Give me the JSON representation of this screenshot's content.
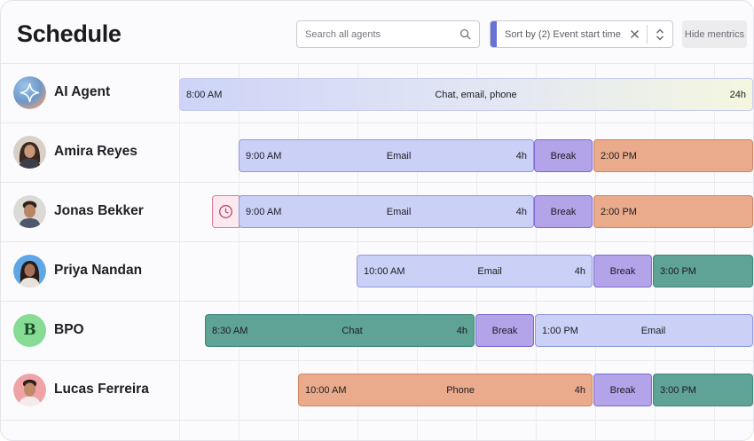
{
  "header": {
    "title": "Schedule",
    "search_placeholder": "Search all agents",
    "sort_label": "Sort by (2) Event start time",
    "hide_metrics_label": "Hide mentrics"
  },
  "rows": [
    {
      "name": "AI Agent",
      "avatar": "ai-sparkle-icon",
      "segments": [
        {
          "type": "ai",
          "start": "8:00 AM",
          "label": "Chat, email, phone",
          "duration": "24h"
        }
      ]
    },
    {
      "name": "Amira Reyes",
      "avatar": "person-photo",
      "segments": [
        {
          "type": "email",
          "start": "9:00 AM",
          "label": "Email",
          "duration": "4h"
        },
        {
          "type": "break",
          "label": "Break"
        },
        {
          "type": "phone",
          "start": "2:00 PM"
        }
      ]
    },
    {
      "name": "Jonas Bekker",
      "avatar": "person-photo",
      "late_icon": "clock-icon",
      "segments": [
        {
          "type": "email",
          "start": "9:00 AM",
          "label": "Email",
          "duration": "4h"
        },
        {
          "type": "break",
          "label": "Break"
        },
        {
          "type": "phone",
          "start": "2:00 PM"
        }
      ]
    },
    {
      "name": "Priya Nandan",
      "avatar": "person-photo",
      "segments": [
        {
          "type": "email",
          "start": "10:00 AM",
          "label": "Email",
          "duration": "4h"
        },
        {
          "type": "break",
          "label": "Break"
        },
        {
          "type": "chat",
          "start": "3:00 PM"
        }
      ]
    },
    {
      "name": "BPO",
      "avatar": "bpo-letter",
      "avatar_letter": "B",
      "segments": [
        {
          "type": "chat",
          "start": "8:30 AM",
          "label": "Chat",
          "duration": "4h"
        },
        {
          "type": "break",
          "label": "Break"
        },
        {
          "type": "email",
          "start": "1:00 PM",
          "label": "Email"
        }
      ]
    },
    {
      "name": "Lucas Ferreira",
      "avatar": "person-photo",
      "segments": [
        {
          "type": "phone",
          "start": "10:00 AM",
          "label": "Phone",
          "duration": "4h"
        },
        {
          "type": "break",
          "label": "Break"
        },
        {
          "type": "chat",
          "start": "3:00 PM"
        }
      ]
    }
  ],
  "colors": {
    "email": "#cbd0f7",
    "break": "#b3a4ea",
    "phone": "#eaaa8c",
    "chat": "#5fa296",
    "accent": "#6672d6"
  }
}
